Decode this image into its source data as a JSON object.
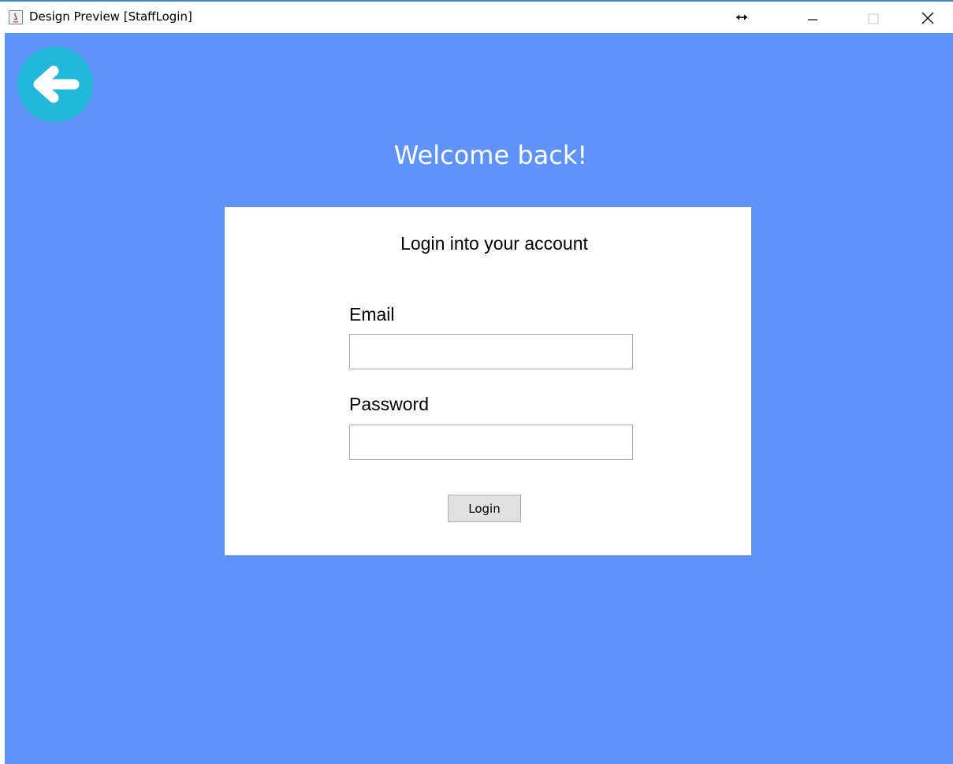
{
  "window": {
    "title": "Design Preview [StaffLogin]"
  },
  "caption_icons": [
    "resize-icon",
    "minimize-icon",
    "maximize-icon",
    "close-icon"
  ],
  "page": {
    "welcome": "Welcome back!",
    "back_icon": "arrow-left-icon"
  },
  "login_card": {
    "heading": "Login into your account",
    "email_label": "Email",
    "email_value": "",
    "password_label": "Password",
    "password_value": "",
    "login_label": "Login"
  },
  "colors": {
    "background": "#5f93f7",
    "back_button": "#23b8d8",
    "card": "#ffffff",
    "button": "#e1e1e1"
  }
}
